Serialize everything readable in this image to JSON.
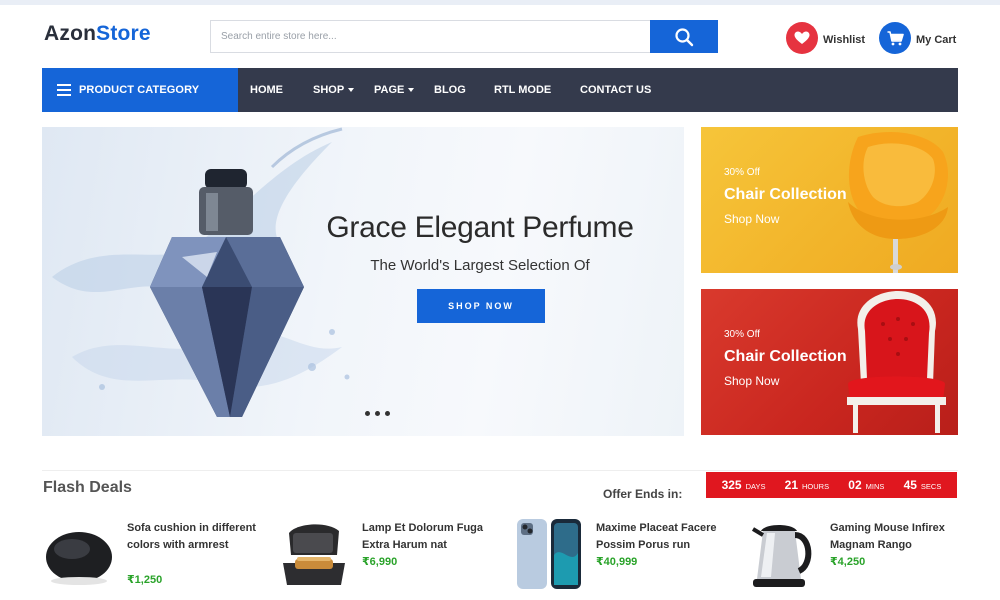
{
  "header": {
    "logo_part1": "Azon",
    "logo_part2": "Store",
    "search_placeholder": "Search entire store here...",
    "wishlist_label": "Wishlist",
    "cart_label": "My Cart"
  },
  "nav": {
    "category_label": "PRODUCT CATEGORY",
    "items": [
      {
        "label": "HOME",
        "has_dropdown": false
      },
      {
        "label": "SHOP",
        "has_dropdown": true
      },
      {
        "label": "PAGE",
        "has_dropdown": true
      },
      {
        "label": "BLOG",
        "has_dropdown": false
      },
      {
        "label": "RTL MODE",
        "has_dropdown": false
      },
      {
        "label": "CONTACT US",
        "has_dropdown": false
      }
    ]
  },
  "hero": {
    "title": "Grace Elegant Perfume",
    "subtitle": "The World's Largest Selection Of",
    "button_label": "SHOP NOW",
    "slide_count": 3
  },
  "banners": [
    {
      "discount": "30% Off",
      "title": "Chair Collection",
      "link": "Shop Now",
      "color": "#f2b42a"
    },
    {
      "discount": "30% Off",
      "title": "Chair Collection",
      "link": "Shop Now",
      "color": "#c9261f"
    }
  ],
  "flash_deals": {
    "title": "Flash Deals",
    "offer_label": "Offer Ends in:",
    "countdown": [
      {
        "value": "325",
        "unit": "DAYS"
      },
      {
        "value": "21",
        "unit": "HOURS"
      },
      {
        "value": "02",
        "unit": "MINS"
      },
      {
        "value": "45",
        "unit": "SECS"
      }
    ],
    "products": [
      {
        "name": "Sofa cushion in different colors with armrest",
        "price": "₹1,250",
        "icon": "mouse-icon"
      },
      {
        "name": "Lamp Et Dolorum Fuga Extra Harum nat",
        "price": "₹6,990",
        "icon": "sandwich-maker-icon"
      },
      {
        "name": "Maxime Placeat Facere Possim Porus run",
        "price": "₹40,999",
        "icon": "phone-icon"
      },
      {
        "name": "Gaming Mouse Infirex Magnam Rango",
        "price": "₹4,250",
        "icon": "kettle-icon"
      }
    ]
  },
  "colors": {
    "primary": "#1565d8",
    "nav_bg": "#343a4c",
    "wishlist": "#e63340",
    "countdown_bg": "#e0171f",
    "price": "#2aa32a"
  }
}
